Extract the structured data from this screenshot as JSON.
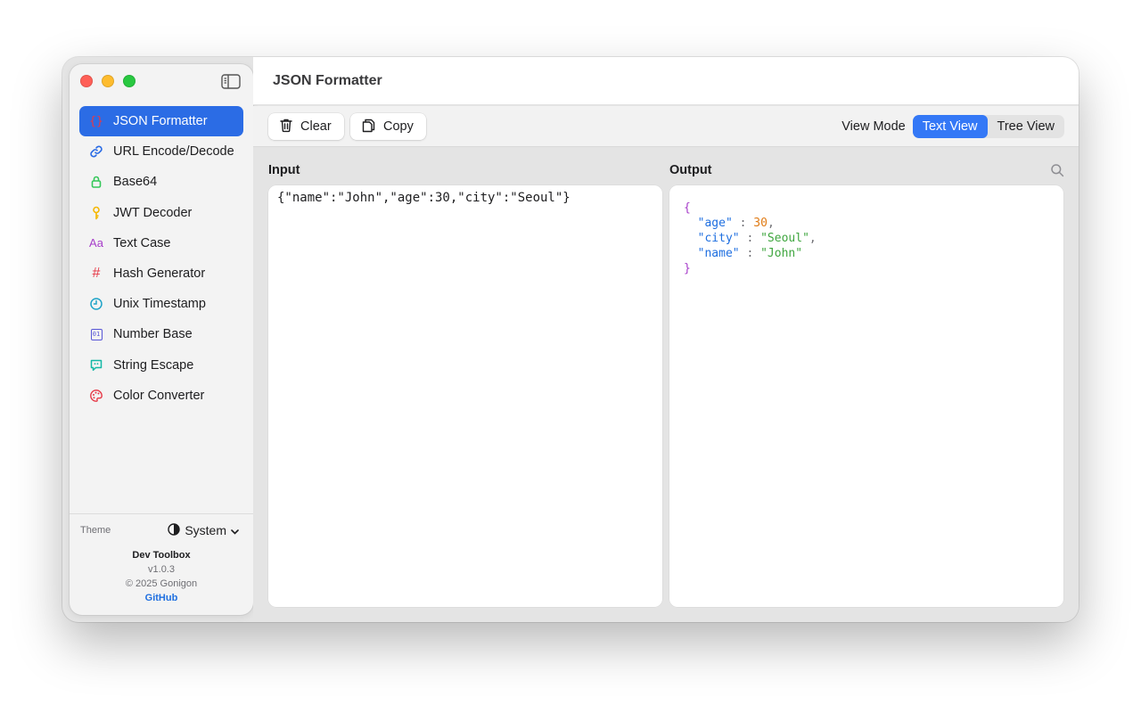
{
  "window": {
    "title": "JSON Formatter"
  },
  "sidebar": {
    "items": [
      {
        "label": "JSON Formatter",
        "icon": "braces-icon",
        "color": "#ffffff",
        "active": true
      },
      {
        "label": "URL Encode/Decode",
        "icon": "link-icon",
        "color": "#2b6ce5"
      },
      {
        "label": "Base64",
        "icon": "lock-icon",
        "color": "#34c759"
      },
      {
        "label": "JWT Decoder",
        "icon": "key-icon",
        "color": "#f5b700"
      },
      {
        "label": "Text Case",
        "icon": "text-case-icon",
        "color": "#a63cc9"
      },
      {
        "label": "Hash Generator",
        "icon": "hash-icon",
        "color": "#e63947"
      },
      {
        "label": "Unix Timestamp",
        "icon": "clock-icon",
        "color": "#1fa4c8"
      },
      {
        "label": "Number Base",
        "icon": "binary-icon",
        "color": "#5856d6"
      },
      {
        "label": "String Escape",
        "icon": "quote-bubble-icon",
        "color": "#14b8a6"
      },
      {
        "label": "Color Converter",
        "icon": "palette-icon",
        "color": "#e63947"
      }
    ],
    "icon_glyphs": {
      "braces": "{}",
      "text_case": "Aa",
      "hash": "#",
      "binary": "01"
    },
    "footer": {
      "theme_label": "Theme",
      "theme_value": "System",
      "app_name": "Dev Toolbox",
      "version": "v1.0.3",
      "copyright": "© 2025 Gonigon",
      "link": "GitHub"
    }
  },
  "toolbar": {
    "clear_label": "Clear",
    "copy_label": "Copy",
    "view_mode_label": "View Mode",
    "view_modes": [
      "Text View",
      "Tree View"
    ],
    "active_view_mode": "Text View"
  },
  "panels": {
    "input_label": "Input",
    "output_label": "Output",
    "input_value": "{\"name\":\"John\",\"age\":30,\"city\":\"Seoul\"}",
    "output_lines": [
      {
        "tokens": [
          {
            "t": "{",
            "c": "brace"
          }
        ]
      },
      {
        "tokens": [
          {
            "t": "  ",
            "c": "punct"
          },
          {
            "t": "\"age\"",
            "c": "key"
          },
          {
            "t": " : ",
            "c": "punct"
          },
          {
            "t": "30",
            "c": "num"
          },
          {
            "t": ",",
            "c": "punct"
          }
        ]
      },
      {
        "tokens": [
          {
            "t": "  ",
            "c": "punct"
          },
          {
            "t": "\"city\"",
            "c": "key"
          },
          {
            "t": " : ",
            "c": "punct"
          },
          {
            "t": "\"Seoul\"",
            "c": "str"
          },
          {
            "t": ",",
            "c": "punct"
          }
        ]
      },
      {
        "tokens": [
          {
            "t": "  ",
            "c": "punct"
          },
          {
            "t": "\"name\"",
            "c": "key"
          },
          {
            "t": " : ",
            "c": "punct"
          },
          {
            "t": "\"John\"",
            "c": "str"
          }
        ]
      },
      {
        "tokens": [
          {
            "t": "}",
            "c": "brace"
          }
        ]
      }
    ]
  },
  "colors": {
    "accent": "#2b6ce5",
    "segment_active": "#3478f6",
    "json_brace": "#a63cc9",
    "json_key": "#1f6fe0",
    "json_number": "#e07b15",
    "json_string": "#3fa63f"
  }
}
